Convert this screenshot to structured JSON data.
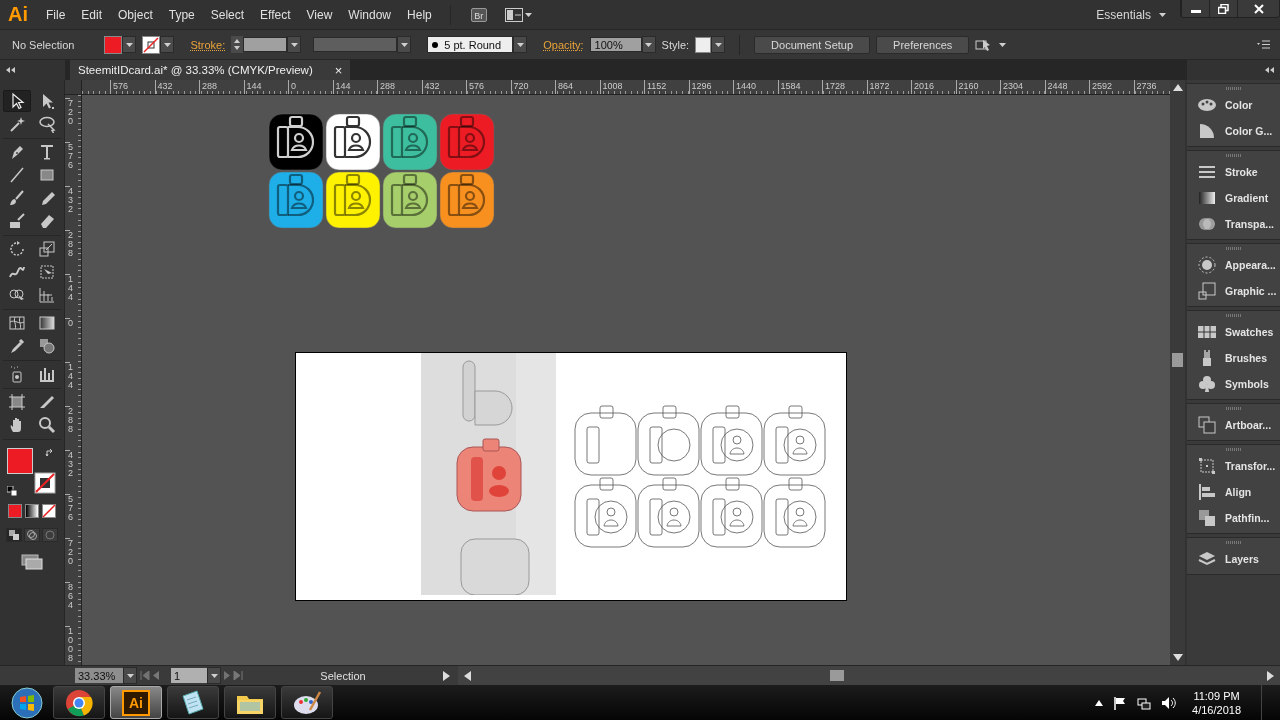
{
  "app_bar": {
    "logo": "Ai",
    "menus": [
      "File",
      "Edit",
      "Object",
      "Type",
      "Select",
      "Effect",
      "View",
      "Window",
      "Help"
    ],
    "bridge_button": "Br",
    "workspace": "Essentials"
  },
  "control_bar": {
    "selection": "No Selection",
    "fill": {
      "color": "#ed1c24"
    },
    "stroke_label": "Stroke:",
    "brush": "5 pt. Round",
    "opacity_label": "Opacity:",
    "opacity": "100%",
    "style_label": "Style:",
    "buttons": [
      "Document Setup",
      "Preferences"
    ]
  },
  "document_tab": {
    "title": "SteemitIDcard.ai* @ 33.33% (CMYK/Preview)",
    "close": "×"
  },
  "toolbox": {
    "fill": {
      "color": "#ed1c24"
    },
    "tools": [
      {
        "selected": true
      },
      {
        "selected": false
      },
      {
        "selected": false
      },
      {
        "selected": false
      },
      {
        "selected": false
      },
      {
        "selected": false
      },
      {
        "selected": false
      },
      {
        "selected": false
      },
      {
        "selected": false
      },
      {
        "selected": false
      },
      {
        "selected": false
      },
      {
        "selected": false
      },
      {
        "selected": false
      },
      {
        "selected": false
      },
      {
        "selected": false
      },
      {
        "selected": false
      },
      {
        "selected": false
      },
      {
        "selected": false
      },
      {
        "selected": false
      },
      {
        "selected": false
      },
      {
        "selected": false
      },
      {
        "selected": false
      },
      {
        "selected": false
      },
      {
        "selected": false
      },
      {
        "selected": false
      },
      {
        "selected": false
      },
      {
        "selected": false
      },
      {
        "selected": false
      }
    ]
  },
  "rulers": {
    "horizontal": [
      "576",
      "432",
      "288",
      "144",
      "0",
      "144",
      "288",
      "432",
      "576",
      "720",
      "864",
      "1008",
      "1152",
      "1296",
      "1440",
      "1584",
      "1728",
      "1872",
      "2016",
      "2160",
      "2304",
      "2448",
      "2592",
      "2736"
    ],
    "vertical": [
      "720",
      "576",
      "432",
      "288",
      "144",
      "0",
      "144",
      "288",
      "432",
      "576",
      "720",
      "864",
      "1008"
    ]
  },
  "canvas": {
    "tiles": [
      {
        "color": "#000000"
      },
      {
        "color": "#ffffff"
      },
      {
        "color": "#3dbf9f"
      },
      {
        "color": "#ed1c24"
      },
      {
        "color": "#1eaee8"
      },
      {
        "color": "#fff200"
      },
      {
        "color": "#a6ce6a"
      },
      {
        "color": "#f7901e"
      }
    ]
  },
  "panels": [
    {
      "items": [
        "Color",
        "Color G..."
      ]
    },
    {
      "items": [
        "Stroke",
        "Gradient",
        "Transpa..."
      ]
    },
    {
      "items": [
        "Appeara...",
        "Graphic ..."
      ]
    },
    {
      "items": [
        "Swatches",
        "Brushes",
        "Symbols"
      ]
    },
    {
      "items": [
        "Artboar..."
      ]
    },
    {
      "items": [
        "Transfor...",
        "Align",
        "Pathfin..."
      ]
    },
    {
      "items": [
        "Layers"
      ]
    }
  ],
  "status_bar": {
    "zoom": "33.33%",
    "artboard": "1",
    "tool": "Selection"
  },
  "taskbar": {
    "apps": [
      {
        "selected": false
      },
      {
        "selected": true,
        "label": "Ai"
      },
      {
        "selected": false
      },
      {
        "selected": false
      },
      {
        "selected": false
      }
    ],
    "time": "11:09 PM",
    "date": "4/16/2018"
  }
}
